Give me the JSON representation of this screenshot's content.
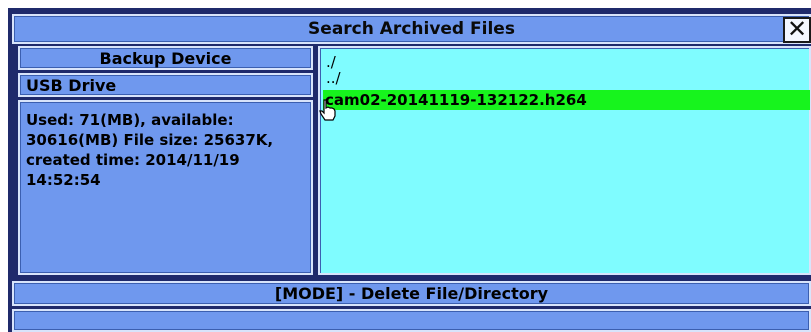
{
  "window": {
    "title": "Search Archived Files",
    "close_icon": "close-icon"
  },
  "sidebar": {
    "device_label": "Backup Device",
    "device_value": "USB Drive",
    "file_info": "Used: 71(MB), available: 30616(MB) File size: 25637K, created time: 2014/11/19 14:52:54"
  },
  "file_list": {
    "items": [
      {
        "name": "./",
        "selected": false
      },
      {
        "name": "../",
        "selected": false
      },
      {
        "name": "cam02-20141119-132122.h264",
        "selected": true
      }
    ]
  },
  "footer": {
    "mode_hint": "[MODE] - Delete File/Directory",
    "status": ""
  },
  "colors": {
    "panel": "#6f98ee",
    "list_bg": "#7ffcff",
    "selection": "#17f41d",
    "frame": "#1f2a6b"
  }
}
